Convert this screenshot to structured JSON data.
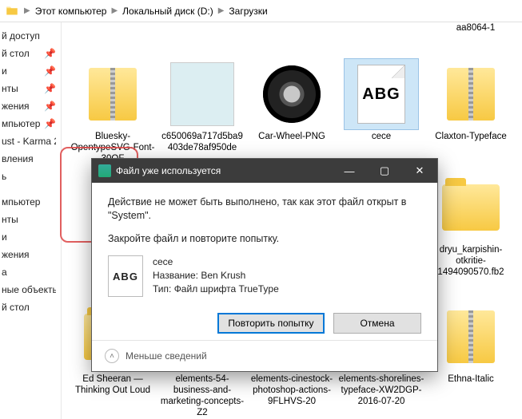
{
  "breadcrumb": {
    "seg1": "Этот компьютер",
    "seg2": "Локальный диск (D:)",
    "seg3": "Загрузки"
  },
  "sidebar": {
    "items": [
      {
        "label": "й доступ",
        "pin": false
      },
      {
        "label": "й стол",
        "pin": true
      },
      {
        "label": "и",
        "pin": true
      },
      {
        "label": "нты",
        "pin": true
      },
      {
        "label": "жения",
        "pin": true
      },
      {
        "label": "мпьютер",
        "pin": true
      },
      {
        "label": "ust - Karma 2",
        "pin": false
      },
      {
        "label": "вления",
        "pin": false
      },
      {
        "label": "ь",
        "pin": false
      }
    ],
    "items2": [
      {
        "label": "мпьютер"
      },
      {
        "label": "нты"
      },
      {
        "label": "и"
      },
      {
        "label": "жения"
      },
      {
        "label": "а"
      },
      {
        "label": "ные объекты"
      },
      {
        "label": "й стол"
      }
    ]
  },
  "files": {
    "r0": [
      {
        "name": "aa8064-1"
      }
    ],
    "r1": [
      {
        "name": "Bluesky-OpentypeSVG-Font-30OF"
      },
      {
        "name": "c650069a717d5ba9403de78af950de"
      },
      {
        "name": "Car-Wheel-PNG"
      },
      {
        "name": "cece"
      },
      {
        "name": "Claxton-Typeface"
      }
    ],
    "r2_last": {
      "name": "dryu_karpishin-otkritie-1494090570.fb2"
    },
    "r3": [
      {
        "name": "Ed Sheeran — Thinking Out Loud"
      },
      {
        "name": "elements-54-business-and-marketing-concepts-Z2"
      },
      {
        "name": "elements-cinestock-photoshop-actions-9FLHVS-20"
      },
      {
        "name": "elements-shorelines-typeface-XW2DGP-2016-07-20"
      },
      {
        "name": "Ethna-Italic"
      }
    ]
  },
  "dialog": {
    "title": "Файл уже используется",
    "msg1": "Действие не может быть выполнено, так как этот файл открыт в \"System\".",
    "msg2": "Закройте файл и повторите попытку.",
    "file": {
      "name": "cece",
      "author_label": "Название:",
      "author": "Ben Krush",
      "type_label": "Тип:",
      "type": "Файл шрифта TrueType"
    },
    "retry": "Повторить попытку",
    "cancel": "Отмена",
    "less": "Меньше сведений"
  }
}
